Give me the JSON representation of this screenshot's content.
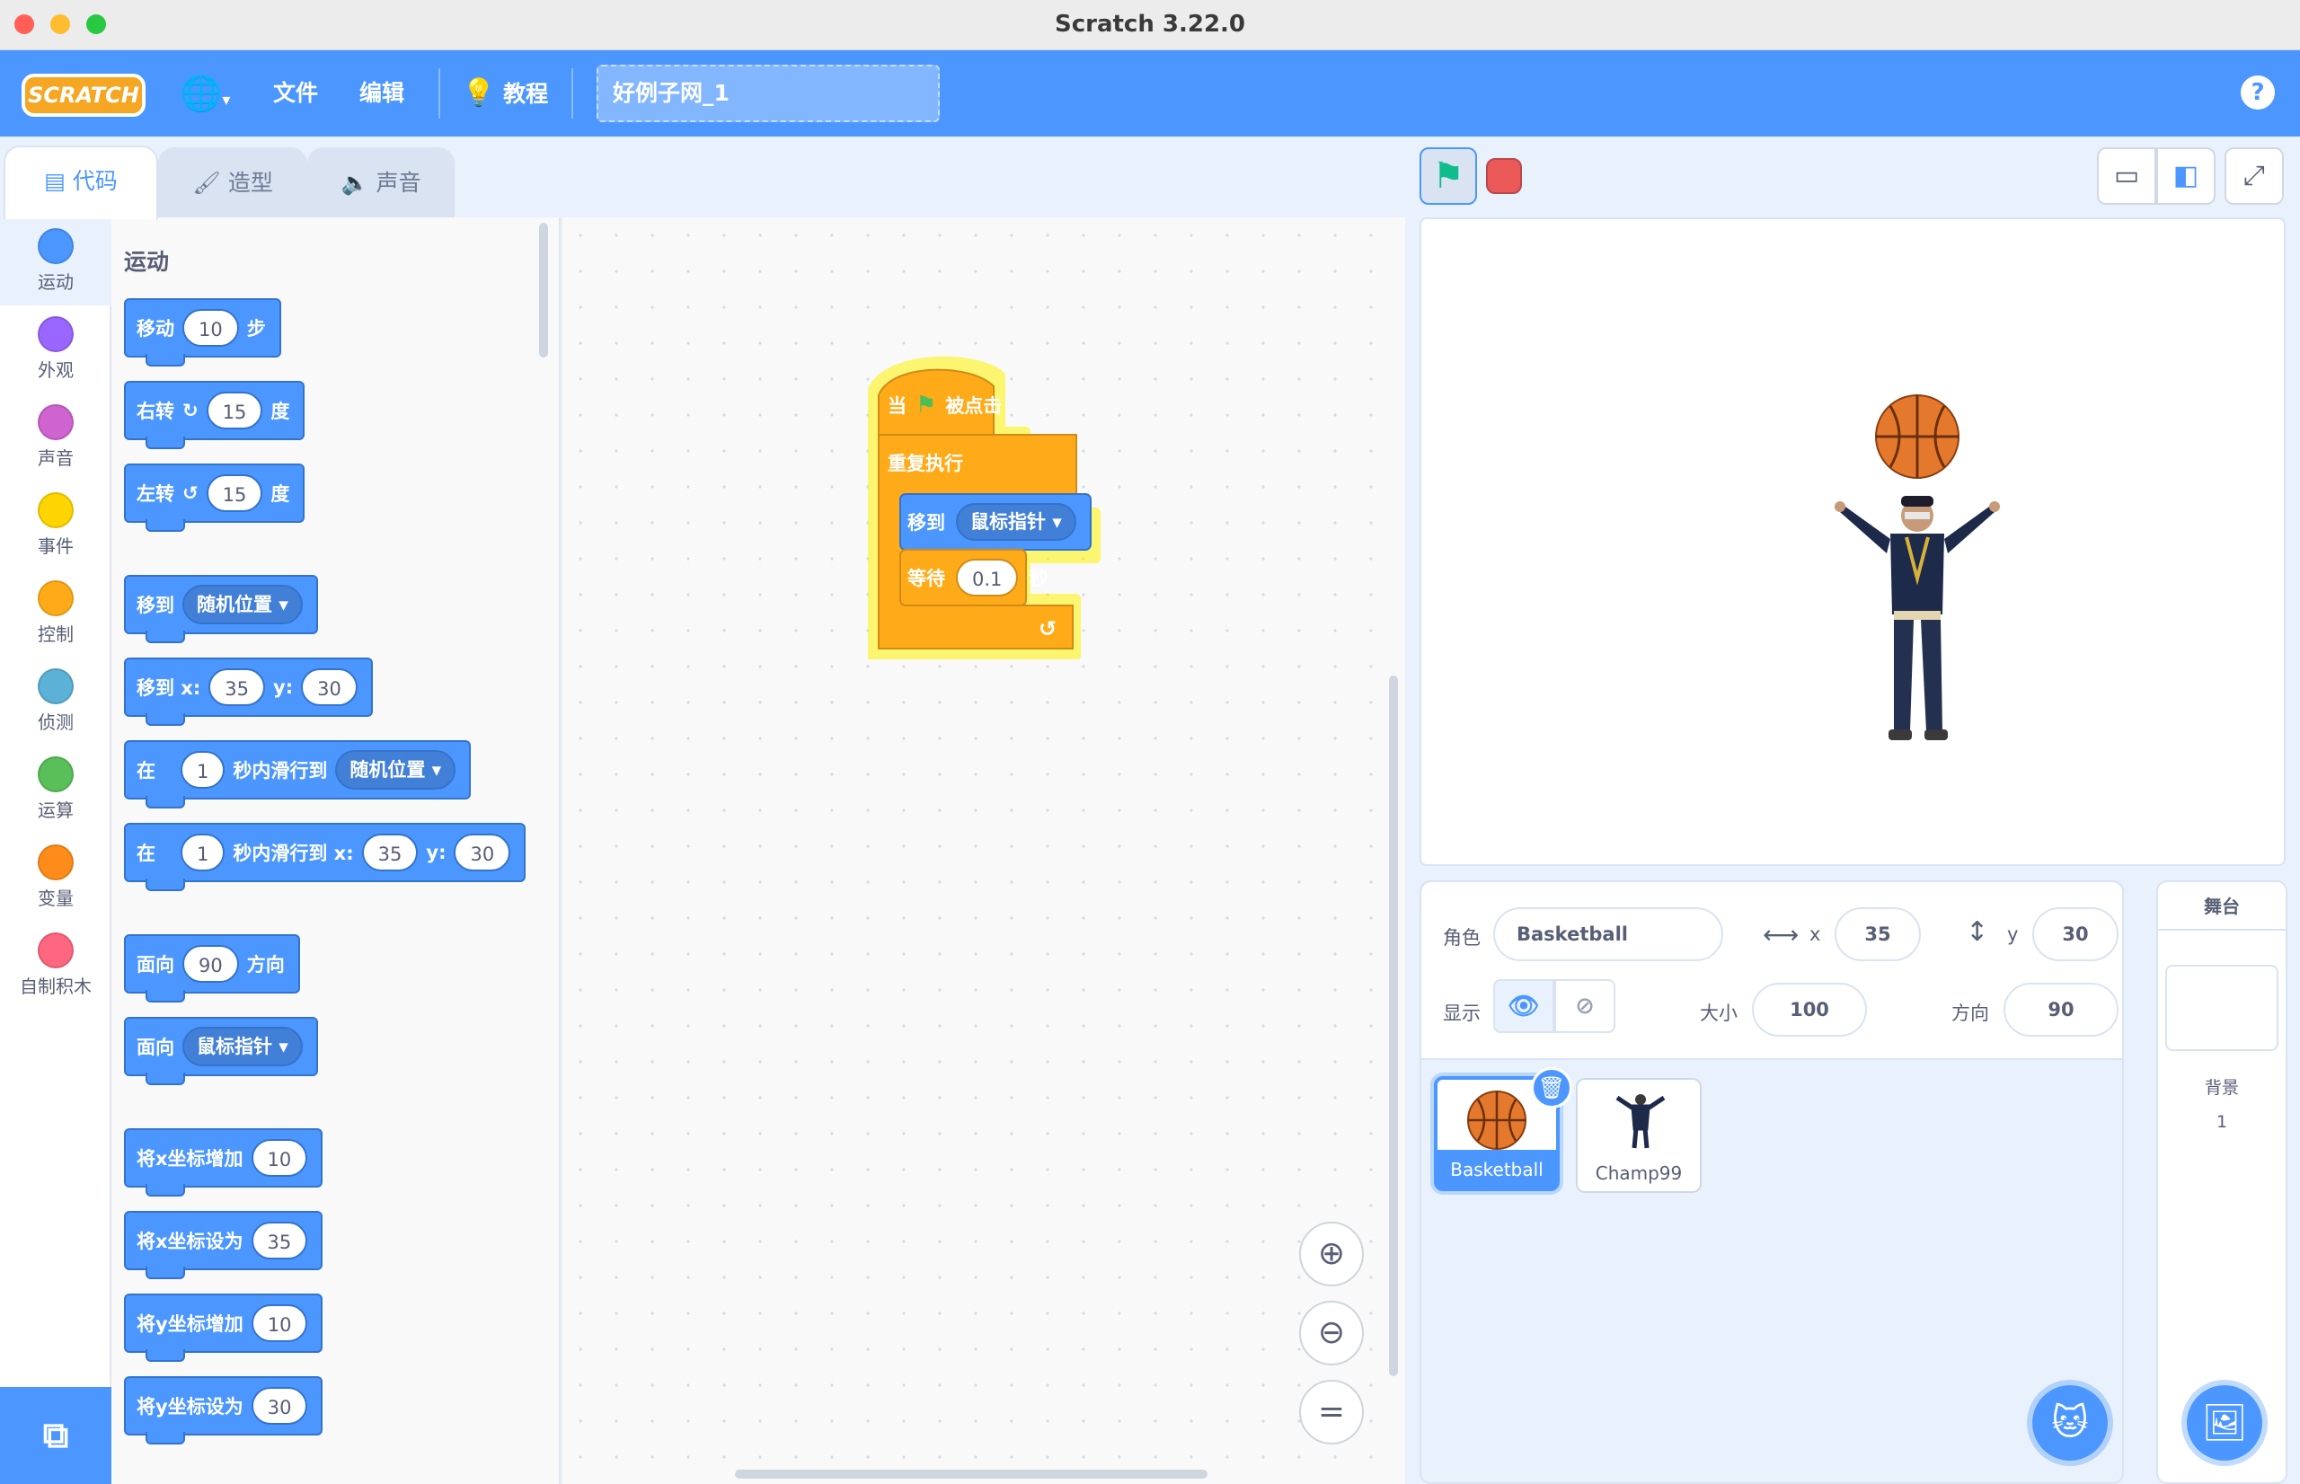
{
  "window": {
    "title": "Scratch 3.22.0"
  },
  "menu": {
    "logo": "SCRATCH",
    "file": "文件",
    "edit": "编辑",
    "tutorials": "教程",
    "project_title": "好例子网_1",
    "help": "?"
  },
  "tabs": [
    {
      "label": "代码"
    },
    {
      "label": "造型"
    },
    {
      "label": "声音"
    }
  ],
  "categories": [
    {
      "label": "运动",
      "color": "#4c97ff"
    },
    {
      "label": "外观",
      "color": "#9966ff"
    },
    {
      "label": "声音",
      "color": "#cf63cf"
    },
    {
      "label": "事件",
      "color": "#ffd500"
    },
    {
      "label": "控制",
      "color": "#ffab19"
    },
    {
      "label": "侦测",
      "color": "#5cb1d6"
    },
    {
      "label": "运算",
      "color": "#59c059"
    },
    {
      "label": "变量",
      "color": "#ff8c1a"
    },
    {
      "label": "自制积木",
      "color": "#ff6680"
    }
  ],
  "palette": {
    "section": "运动",
    "b1": {
      "a": "移动",
      "v": "10",
      "b": "步"
    },
    "b2": {
      "a": "右转",
      "v": "15",
      "b": "度"
    },
    "b3": {
      "a": "左转",
      "v": "15",
      "b": "度"
    },
    "b4": {
      "a": "移到",
      "d": "随机位置"
    },
    "b5": {
      "a": "移到 x:",
      "x": "35",
      "y_lbl": "y:",
      "y": "30"
    },
    "b6": {
      "a": "在",
      "v": "1",
      "b": "秒内滑行到",
      "d": "随机位置"
    },
    "b7": {
      "a": "在",
      "v": "1",
      "b": "秒内滑行到 x:",
      "x": "35",
      "y_lbl": "y:",
      "y": "30"
    },
    "b8": {
      "a": "面向",
      "v": "90",
      "b": "方向"
    },
    "b9": {
      "a": "面向",
      "d": "鼠标指针"
    },
    "b10": {
      "a": "将x坐标增加",
      "v": "10"
    },
    "b11": {
      "a": "将x坐标设为",
      "v": "35"
    },
    "b12": {
      "a": "将y坐标增加",
      "v": "10"
    },
    "b13": {
      "a": "将y坐标设为",
      "v": "30"
    }
  },
  "script": {
    "hat_a": "当",
    "hat_b": "被点击",
    "forever": "重复执行",
    "goto": "移到",
    "goto_target": "鼠标指针",
    "wait": "等待",
    "wait_val": "0.1",
    "wait_unit": "秒"
  },
  "sprite_info": {
    "sprite_label": "角色",
    "sprite_name": "Basketball",
    "x_label": "x",
    "x": "35",
    "y_label": "y",
    "y": "30",
    "show_label": "显示",
    "size_label": "大小",
    "size": "100",
    "direction_label": "方向",
    "direction": "90"
  },
  "sprites": [
    {
      "name": "Basketball"
    },
    {
      "name": "Champ99"
    }
  ],
  "stage_panel": {
    "title": "舞台",
    "backdrops_label": "背景",
    "backdrops_count": "1"
  }
}
